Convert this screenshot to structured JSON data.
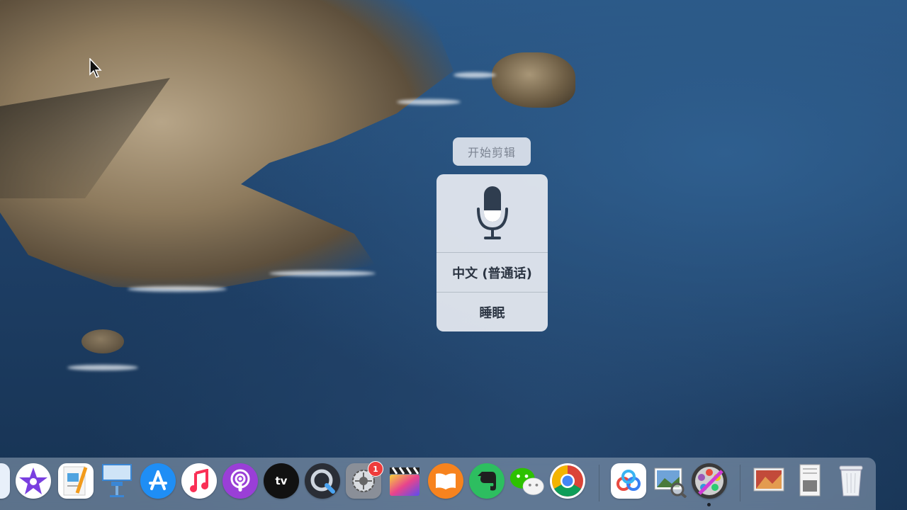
{
  "desktop": {
    "wallpaper": "Catalina coastal cliffs"
  },
  "dictation": {
    "hint": "开始剪辑",
    "language": "中文 (普通话)",
    "sleep_label": "睡眠",
    "mic_icon": "microphone-icon"
  },
  "dock": {
    "items": [
      {
        "name": "finder-partial",
        "icon": "finder-icon"
      },
      {
        "name": "imovie",
        "icon": "imovie-star-icon"
      },
      {
        "name": "pages",
        "icon": "pages-icon"
      },
      {
        "name": "keynote",
        "icon": "keynote-podium-icon"
      },
      {
        "name": "app-store",
        "icon": "app-store-icon"
      },
      {
        "name": "music",
        "icon": "music-note-icon"
      },
      {
        "name": "podcasts",
        "icon": "podcasts-icon"
      },
      {
        "name": "apple-tv",
        "icon": "apple-tv-icon",
        "label": "tv"
      },
      {
        "name": "quicktime",
        "icon": "quicktime-icon"
      },
      {
        "name": "system-preferences",
        "icon": "gear-icon",
        "badge": "1"
      },
      {
        "name": "final-cut-pro",
        "icon": "clapperboard-icon"
      },
      {
        "name": "books",
        "icon": "book-icon"
      },
      {
        "name": "evernote",
        "icon": "elephant-icon"
      },
      {
        "name": "wechat",
        "icon": "wechat-icon"
      },
      {
        "name": "chrome",
        "icon": "chrome-icon"
      },
      {
        "name": "baidu-netdisk",
        "icon": "cloud-icon"
      },
      {
        "name": "preview",
        "icon": "preview-icon"
      },
      {
        "name": "photo-booth",
        "icon": "film-reel-icon"
      },
      {
        "name": "downloads-stack",
        "icon": "downloads-icon"
      },
      {
        "name": "documents-stack",
        "icon": "document-icon"
      },
      {
        "name": "trash",
        "icon": "trash-icon"
      }
    ],
    "colors": {
      "app_store": "#1f8ef5",
      "music": "#fa2f55",
      "podcasts": "#9a3fd7",
      "books": "#f7831e",
      "evernote": "#2dbe60",
      "wechat": "#2dc100",
      "badge": "#ee3b3b"
    }
  }
}
